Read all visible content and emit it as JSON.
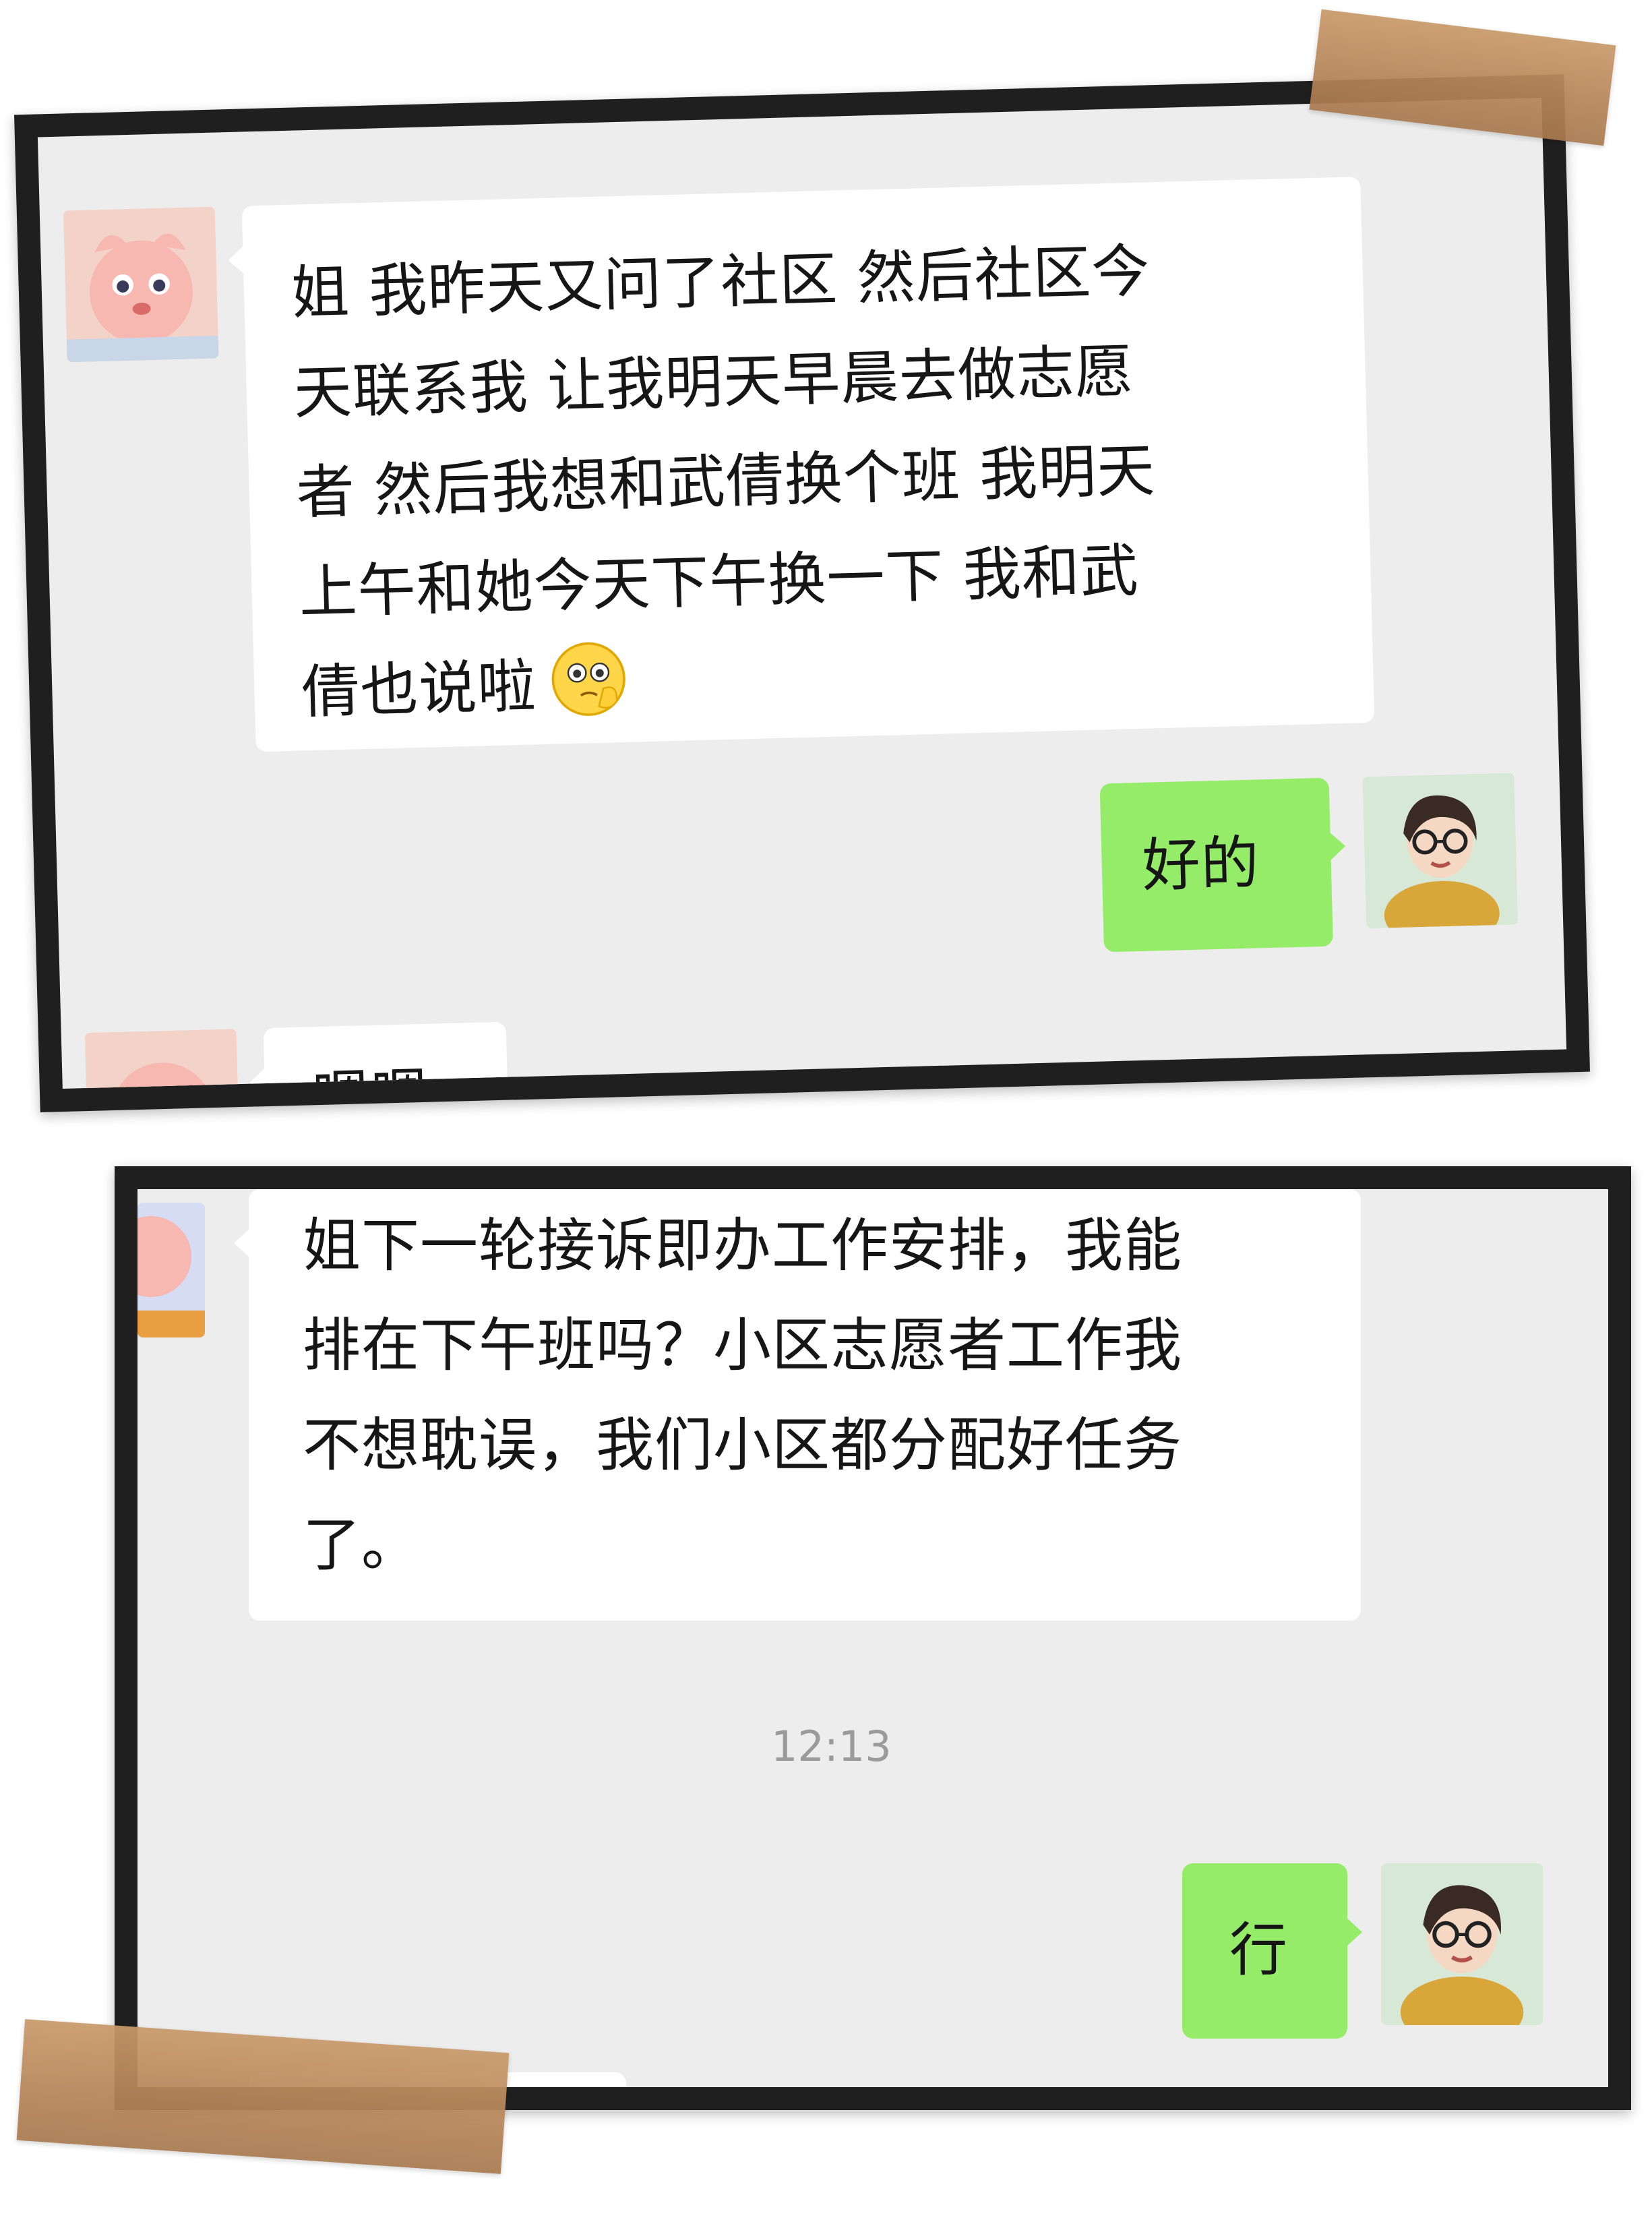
{
  "screenshot_1": {
    "messages": [
      {
        "sender": "other",
        "text": "姐 我昨天又问了社区 然后社区今\n天联系我 让我明天早晨去做志愿\n者 然后我想和武倩换个班 我明天\n上午和她今天下午换一下 我和武\n倩也说啦",
        "emoji": "thinking-emoji"
      },
      {
        "sender": "me",
        "text": "好的"
      },
      {
        "sender": "other",
        "text": "嗯嗯"
      }
    ]
  },
  "screenshot_2": {
    "messages": [
      {
        "sender": "other",
        "text": "姐下一轮接诉即办工作安排，我能\n排在下午班吗？小区志愿者工作我\n不想耽误，我们小区都分配好任务\n了。"
      },
      {
        "sender": "me",
        "text": "行"
      }
    ],
    "timestamp": "12:13"
  },
  "colors": {
    "chat_background": "#ededed",
    "incoming_bubble": "#ffffff",
    "outgoing_bubble": "#95ec69",
    "frame": "#1f1f1f",
    "tape": "#b8865a",
    "timestamp_text": "#9a9a9a"
  }
}
